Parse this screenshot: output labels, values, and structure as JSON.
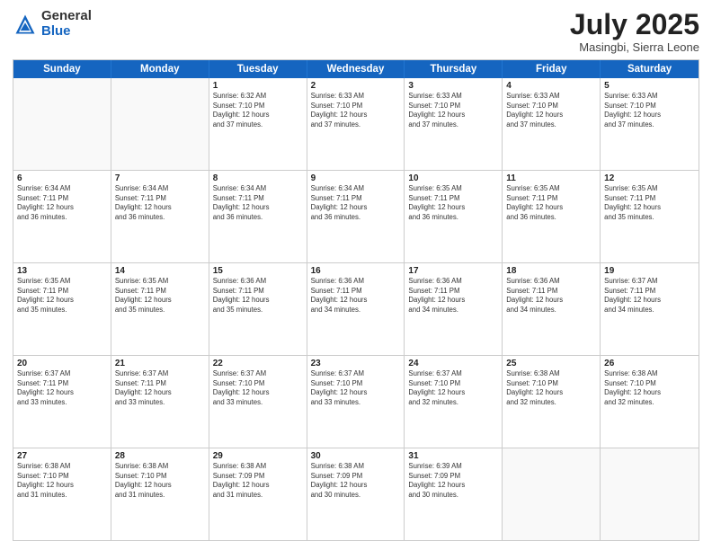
{
  "logo": {
    "general": "General",
    "blue": "Blue"
  },
  "title": "July 2025",
  "subtitle": "Masingbi, Sierra Leone",
  "header_days": [
    "Sunday",
    "Monday",
    "Tuesday",
    "Wednesday",
    "Thursday",
    "Friday",
    "Saturday"
  ],
  "weeks": [
    [
      {
        "day": "",
        "lines": []
      },
      {
        "day": "",
        "lines": []
      },
      {
        "day": "1",
        "lines": [
          "Sunrise: 6:32 AM",
          "Sunset: 7:10 PM",
          "Daylight: 12 hours",
          "and 37 minutes."
        ]
      },
      {
        "day": "2",
        "lines": [
          "Sunrise: 6:33 AM",
          "Sunset: 7:10 PM",
          "Daylight: 12 hours",
          "and 37 minutes."
        ]
      },
      {
        "day": "3",
        "lines": [
          "Sunrise: 6:33 AM",
          "Sunset: 7:10 PM",
          "Daylight: 12 hours",
          "and 37 minutes."
        ]
      },
      {
        "day": "4",
        "lines": [
          "Sunrise: 6:33 AM",
          "Sunset: 7:10 PM",
          "Daylight: 12 hours",
          "and 37 minutes."
        ]
      },
      {
        "day": "5",
        "lines": [
          "Sunrise: 6:33 AM",
          "Sunset: 7:10 PM",
          "Daylight: 12 hours",
          "and 37 minutes."
        ]
      }
    ],
    [
      {
        "day": "6",
        "lines": [
          "Sunrise: 6:34 AM",
          "Sunset: 7:11 PM",
          "Daylight: 12 hours",
          "and 36 minutes."
        ]
      },
      {
        "day": "7",
        "lines": [
          "Sunrise: 6:34 AM",
          "Sunset: 7:11 PM",
          "Daylight: 12 hours",
          "and 36 minutes."
        ]
      },
      {
        "day": "8",
        "lines": [
          "Sunrise: 6:34 AM",
          "Sunset: 7:11 PM",
          "Daylight: 12 hours",
          "and 36 minutes."
        ]
      },
      {
        "day": "9",
        "lines": [
          "Sunrise: 6:34 AM",
          "Sunset: 7:11 PM",
          "Daylight: 12 hours",
          "and 36 minutes."
        ]
      },
      {
        "day": "10",
        "lines": [
          "Sunrise: 6:35 AM",
          "Sunset: 7:11 PM",
          "Daylight: 12 hours",
          "and 36 minutes."
        ]
      },
      {
        "day": "11",
        "lines": [
          "Sunrise: 6:35 AM",
          "Sunset: 7:11 PM",
          "Daylight: 12 hours",
          "and 36 minutes."
        ]
      },
      {
        "day": "12",
        "lines": [
          "Sunrise: 6:35 AM",
          "Sunset: 7:11 PM",
          "Daylight: 12 hours",
          "and 35 minutes."
        ]
      }
    ],
    [
      {
        "day": "13",
        "lines": [
          "Sunrise: 6:35 AM",
          "Sunset: 7:11 PM",
          "Daylight: 12 hours",
          "and 35 minutes."
        ]
      },
      {
        "day": "14",
        "lines": [
          "Sunrise: 6:35 AM",
          "Sunset: 7:11 PM",
          "Daylight: 12 hours",
          "and 35 minutes."
        ]
      },
      {
        "day": "15",
        "lines": [
          "Sunrise: 6:36 AM",
          "Sunset: 7:11 PM",
          "Daylight: 12 hours",
          "and 35 minutes."
        ]
      },
      {
        "day": "16",
        "lines": [
          "Sunrise: 6:36 AM",
          "Sunset: 7:11 PM",
          "Daylight: 12 hours",
          "and 34 minutes."
        ]
      },
      {
        "day": "17",
        "lines": [
          "Sunrise: 6:36 AM",
          "Sunset: 7:11 PM",
          "Daylight: 12 hours",
          "and 34 minutes."
        ]
      },
      {
        "day": "18",
        "lines": [
          "Sunrise: 6:36 AM",
          "Sunset: 7:11 PM",
          "Daylight: 12 hours",
          "and 34 minutes."
        ]
      },
      {
        "day": "19",
        "lines": [
          "Sunrise: 6:37 AM",
          "Sunset: 7:11 PM",
          "Daylight: 12 hours",
          "and 34 minutes."
        ]
      }
    ],
    [
      {
        "day": "20",
        "lines": [
          "Sunrise: 6:37 AM",
          "Sunset: 7:11 PM",
          "Daylight: 12 hours",
          "and 33 minutes."
        ]
      },
      {
        "day": "21",
        "lines": [
          "Sunrise: 6:37 AM",
          "Sunset: 7:11 PM",
          "Daylight: 12 hours",
          "and 33 minutes."
        ]
      },
      {
        "day": "22",
        "lines": [
          "Sunrise: 6:37 AM",
          "Sunset: 7:10 PM",
          "Daylight: 12 hours",
          "and 33 minutes."
        ]
      },
      {
        "day": "23",
        "lines": [
          "Sunrise: 6:37 AM",
          "Sunset: 7:10 PM",
          "Daylight: 12 hours",
          "and 33 minutes."
        ]
      },
      {
        "day": "24",
        "lines": [
          "Sunrise: 6:37 AM",
          "Sunset: 7:10 PM",
          "Daylight: 12 hours",
          "and 32 minutes."
        ]
      },
      {
        "day": "25",
        "lines": [
          "Sunrise: 6:38 AM",
          "Sunset: 7:10 PM",
          "Daylight: 12 hours",
          "and 32 minutes."
        ]
      },
      {
        "day": "26",
        "lines": [
          "Sunrise: 6:38 AM",
          "Sunset: 7:10 PM",
          "Daylight: 12 hours",
          "and 32 minutes."
        ]
      }
    ],
    [
      {
        "day": "27",
        "lines": [
          "Sunrise: 6:38 AM",
          "Sunset: 7:10 PM",
          "Daylight: 12 hours",
          "and 31 minutes."
        ]
      },
      {
        "day": "28",
        "lines": [
          "Sunrise: 6:38 AM",
          "Sunset: 7:10 PM",
          "Daylight: 12 hours",
          "and 31 minutes."
        ]
      },
      {
        "day": "29",
        "lines": [
          "Sunrise: 6:38 AM",
          "Sunset: 7:09 PM",
          "Daylight: 12 hours",
          "and 31 minutes."
        ]
      },
      {
        "day": "30",
        "lines": [
          "Sunrise: 6:38 AM",
          "Sunset: 7:09 PM",
          "Daylight: 12 hours",
          "and 30 minutes."
        ]
      },
      {
        "day": "31",
        "lines": [
          "Sunrise: 6:39 AM",
          "Sunset: 7:09 PM",
          "Daylight: 12 hours",
          "and 30 minutes."
        ]
      },
      {
        "day": "",
        "lines": []
      },
      {
        "day": "",
        "lines": []
      }
    ]
  ]
}
